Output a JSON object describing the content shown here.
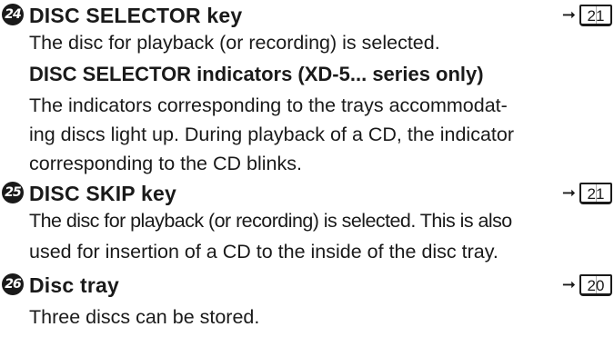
{
  "entries": [
    {
      "number": "24",
      "title": "DISC SELECTOR key",
      "page_ref": "21",
      "description": "The disc for playback (or recording) is selected.",
      "sub_heading": "DISC SELECTOR indicators (XD-5... series only)",
      "sub_lines": [
        "The indicators corresponding to the trays accommodat-",
        "ing discs light up. During playback of a CD, the indicator",
        "corresponding to the CD blinks."
      ]
    },
    {
      "number": "25",
      "title": "DISC SKIP key",
      "page_ref": "21",
      "lines": [
        "The disc for playback (or recording) is selected. This is also",
        "used for insertion of a CD to the inside of the disc tray."
      ]
    },
    {
      "number": "26",
      "title": "Disc tray",
      "page_ref": "20",
      "lines": [
        "Three discs can be stored."
      ]
    }
  ],
  "icons": {
    "arrow": "right-arrow-icon",
    "page_ref": "book-page-icon"
  }
}
